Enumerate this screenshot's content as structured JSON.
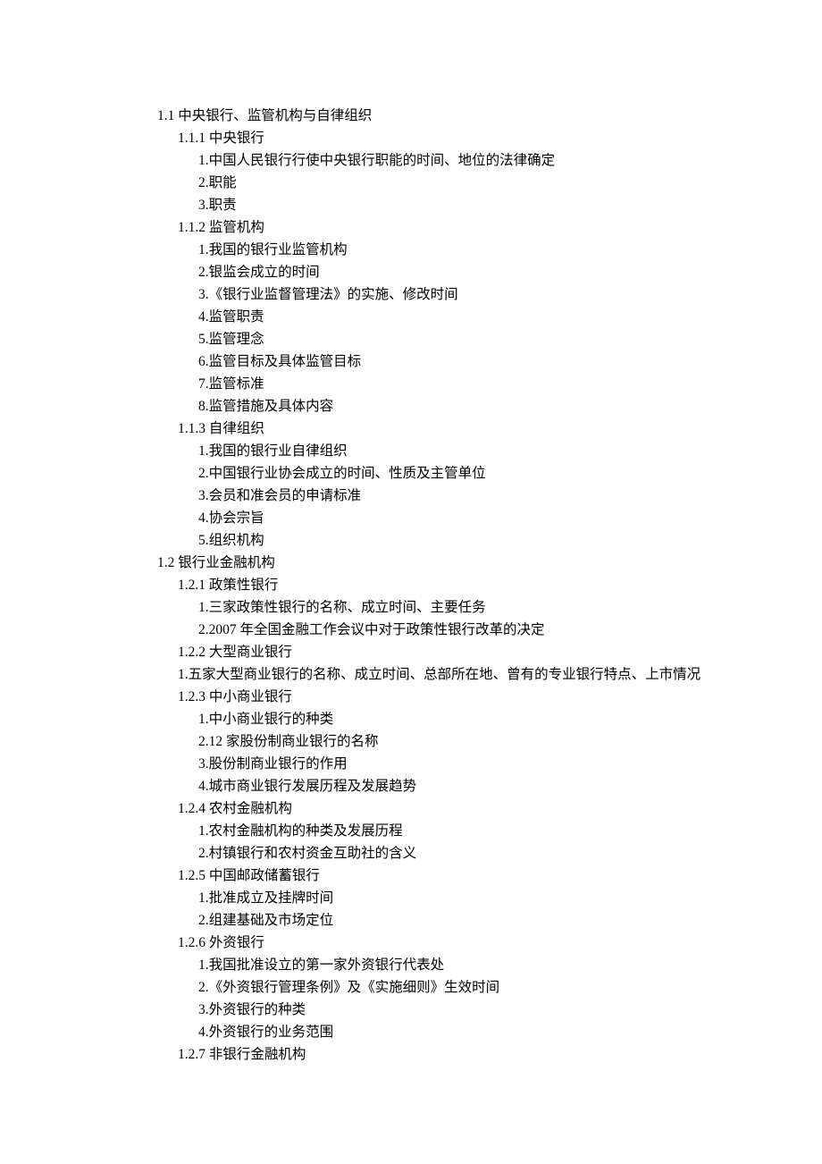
{
  "outline": [
    {
      "level": 0,
      "text": "1.1 中央银行、监管机构与自律组织"
    },
    {
      "level": 1,
      "text": "1.1.1 中央银行"
    },
    {
      "level": 2,
      "text": "1.中国人民银行行使中央银行职能的时间、地位的法律确定"
    },
    {
      "level": 2,
      "text": "2.职能"
    },
    {
      "level": 2,
      "text": "3.职责"
    },
    {
      "level": 1,
      "text": "1.1.2 监管机构"
    },
    {
      "level": 2,
      "text": "1.我国的银行业监管机构"
    },
    {
      "level": 2,
      "text": "2.银监会成立的时间"
    },
    {
      "level": 2,
      "text": "3.《银行业监督管理法》的实施、修改时间"
    },
    {
      "level": 2,
      "text": "4.监管职责"
    },
    {
      "level": 2,
      "text": "5.监管理念"
    },
    {
      "level": 2,
      "text": "6.监管目标及具体监管目标"
    },
    {
      "level": 2,
      "text": "7.监管标准"
    },
    {
      "level": 2,
      "text": "8.监管措施及具体内容"
    },
    {
      "level": 1,
      "text": "1.1.3 自律组织"
    },
    {
      "level": 2,
      "text": "1.我国的银行业自律组织"
    },
    {
      "level": 2,
      "text": "2.中国银行业协会成立的时间、性质及主管单位"
    },
    {
      "level": 2,
      "text": "3.会员和准会员的申请标准"
    },
    {
      "level": 2,
      "text": "4.协会宗旨"
    },
    {
      "level": 2,
      "text": "5.组织机构"
    },
    {
      "level": 0,
      "text": "1.2 银行业金融机构"
    },
    {
      "level": 1,
      "text": "1.2.1 政策性银行"
    },
    {
      "level": 2,
      "text": "1.三家政策性银行的名称、成立时间、主要任务"
    },
    {
      "level": 2,
      "text": "2.2007 年全国金融工作会议中对于政策性银行改革的决定"
    },
    {
      "level": 1,
      "text": "1.2.2 大型商业银行"
    },
    {
      "level": "hang",
      "text": "1.五家大型商业银行的名称、成立时间、总部所在地、曾有的专业银行特点、上市情况"
    },
    {
      "level": 1,
      "text": "1.2.3 中小商业银行"
    },
    {
      "level": 2,
      "text": "1.中小商业银行的种类"
    },
    {
      "level": 2,
      "text": "2.12 家股份制商业银行的名称"
    },
    {
      "level": 2,
      "text": "3.股份制商业银行的作用"
    },
    {
      "level": 2,
      "text": "4.城市商业银行发展历程及发展趋势"
    },
    {
      "level": 1,
      "text": "1.2.4 农村金融机构"
    },
    {
      "level": 2,
      "text": "1.农村金融机构的种类及发展历程"
    },
    {
      "level": 2,
      "text": "2.村镇银行和农村资金互助社的含义"
    },
    {
      "level": 1,
      "text": "1.2.5 中国邮政储蓄银行"
    },
    {
      "level": 2,
      "text": "1.批准成立及挂牌时间"
    },
    {
      "level": 2,
      "text": "2.组建基础及市场定位"
    },
    {
      "level": 1,
      "text": "1.2.6 外资银行"
    },
    {
      "level": 2,
      "text": "1.我国批准设立的第一家外资银行代表处"
    },
    {
      "level": 2,
      "text": "2.《外资银行管理条例》及《实施细则》生效时间"
    },
    {
      "level": 2,
      "text": "3.外资银行的种类"
    },
    {
      "level": 2,
      "text": "4.外资银行的业务范围"
    },
    {
      "level": 1,
      "text": "1.2.7 非银行金融机构"
    }
  ]
}
